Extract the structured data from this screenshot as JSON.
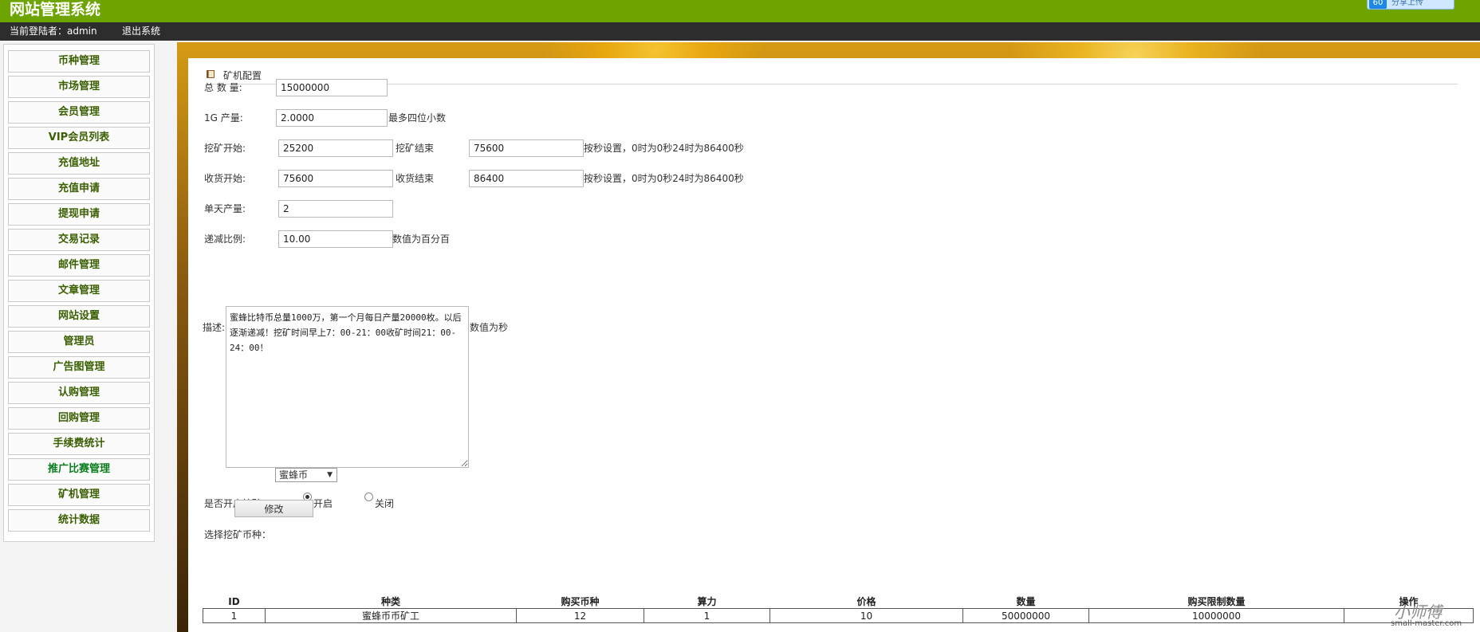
{
  "header": {
    "site_title": "网站管理系统",
    "share_badge": "60",
    "share_label": "分享上传",
    "current_user": "当前登陆者：admin",
    "logout": "退出系统"
  },
  "sidebar": {
    "items": [
      {
        "label": "币种管理"
      },
      {
        "label": "市场管理"
      },
      {
        "label": "会员管理"
      },
      {
        "label": "VIP会员列表"
      },
      {
        "label": "充值地址"
      },
      {
        "label": "充值申请"
      },
      {
        "label": "提现申请"
      },
      {
        "label": "交易记录"
      },
      {
        "label": "邮件管理"
      },
      {
        "label": "文章管理"
      },
      {
        "label": "网站设置"
      },
      {
        "label": "管理员"
      },
      {
        "label": "广告图管理"
      },
      {
        "label": "认购管理"
      },
      {
        "label": "回购管理"
      },
      {
        "label": "手续费统计"
      },
      {
        "label": "推广比赛管理"
      },
      {
        "label": "矿机管理"
      },
      {
        "label": "统计数据"
      }
    ]
  },
  "form": {
    "section_title": "矿机配置",
    "total_label": "总 数 量:",
    "total_value": "15000000",
    "output_label": "1G 产量:",
    "output_value": "2.0000",
    "output_hint": "最多四位小数",
    "mine_start_label": "挖矿开始:",
    "mine_start_value": "25200",
    "mine_end_label": "挖矿结束",
    "mine_end_value": "75600",
    "mine_hint": "按秒设置，0时为0秒24时为86400秒",
    "harvest_start_label": "收货开始:",
    "harvest_start_value": "75600",
    "harvest_end_label": "收货结束",
    "harvest_end_value": "86400",
    "harvest_hint": "按秒设置，0时为0秒24时为86400秒",
    "daily_label": "单天产量:",
    "daily_value": "2",
    "decay_label": "递减比例:",
    "decay_value": "10.00",
    "decay_hint": "数值为百分百",
    "desc_label": "描述:",
    "desc_value": "蜜蜂比特币总量1000万，第一个月每日产量20000枚。以后逐渐递减！挖矿时间早上7：00-21：00收矿时间21：00-24：00！",
    "desc_hint": "数值为秒",
    "enable_label": "是否开启挖矿:",
    "enable_on": "开启",
    "enable_off": "关闭",
    "coin_label": "选择挖矿币种：",
    "coin_value": "蜜蜂币",
    "submit": "修改"
  },
  "table": {
    "headers": [
      "ID",
      "种类",
      "购买币种",
      "算力",
      "价格",
      "数量",
      "购买限制数量",
      "操作"
    ],
    "rows": [
      [
        "1",
        "蜜蜂币币矿工",
        "12",
        "1",
        "10",
        "50000000",
        "10000000",
        ""
      ]
    ]
  },
  "watermark": {
    "text": "小师傅",
    "url": "small-master.com"
  }
}
